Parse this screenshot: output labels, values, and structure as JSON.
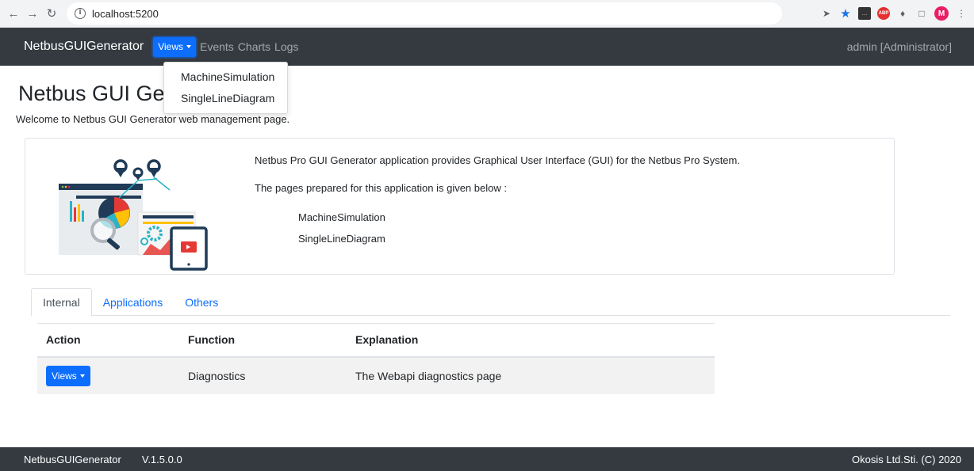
{
  "browser": {
    "url": "localhost:5200",
    "profile_initial": "M",
    "abp_label": "ABP"
  },
  "navbar": {
    "brand": "NetbusGUIGenerator",
    "views_label": "Views",
    "events_label": "Events",
    "charts_label": "Charts",
    "logs_label": "Logs",
    "user": "admin [Administrator]"
  },
  "dropdown": {
    "items": [
      "MachineSimulation",
      "SingleLineDiagram"
    ]
  },
  "page": {
    "title": "Netbus GUI Generator",
    "welcome": "Welcome to Netbus GUI Generator web management page."
  },
  "card": {
    "description": "Netbus Pro GUI Generator application provides Graphical User Interface (GUI) for the Netbus Pro System.",
    "pages_intro": "The pages prepared for this application is given below :",
    "pages": [
      "MachineSimulation",
      "SingleLineDiagram"
    ]
  },
  "tabs": [
    {
      "label": "Internal",
      "active": true
    },
    {
      "label": "Applications",
      "active": false
    },
    {
      "label": "Others",
      "active": false
    }
  ],
  "table": {
    "headers": [
      "Action",
      "Function",
      "Explanation"
    ],
    "rows": [
      {
        "action_label": "Views",
        "function": "Diagnostics",
        "explanation": "The Webapi diagnostics page"
      }
    ]
  },
  "footer": {
    "brand": "NetbusGUIGenerator",
    "version": "V.1.5.0.0",
    "copyright": "Okosis Ltd.Sti. (C) 2020"
  },
  "colors": {
    "navbar_bg": "#343a40",
    "primary": "#0d6efd",
    "footer_bg": "#343a40"
  }
}
